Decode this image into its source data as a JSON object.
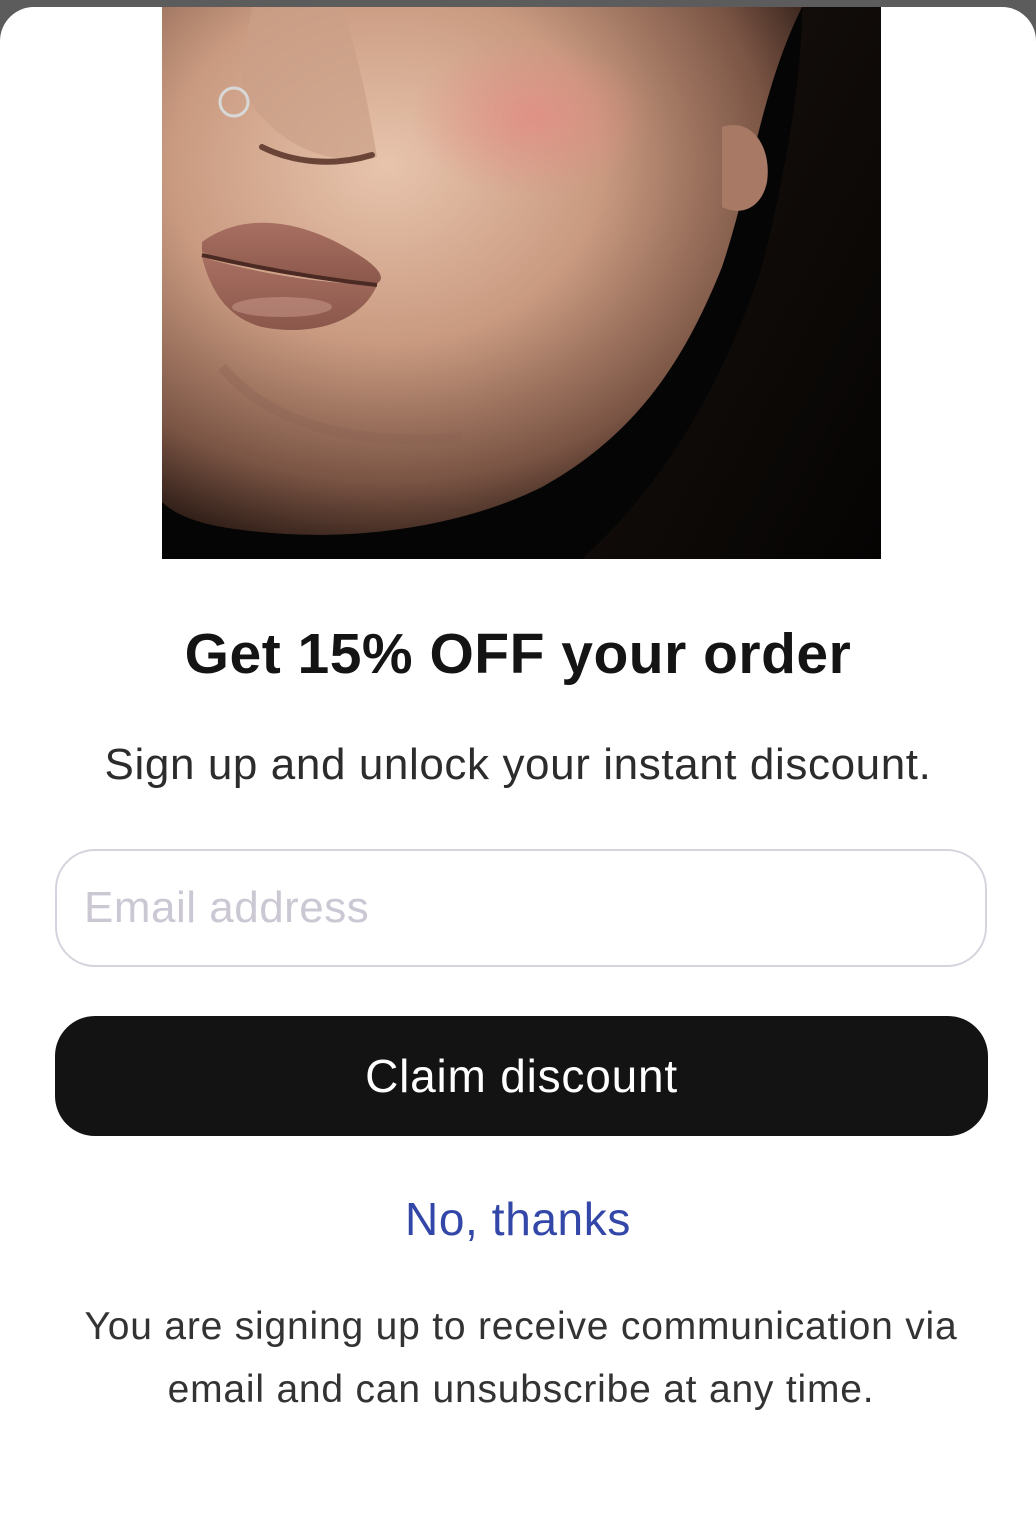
{
  "modal": {
    "headline": "Get 15% OFF your order",
    "subheadline": "Sign up and unlock your instant discount.",
    "email_placeholder": "Email address",
    "claim_label": "Claim discount",
    "dismiss_label": "No, thanks",
    "legal_text": "You are signing up to receive communication via email and can unsubscribe at any time."
  },
  "colors": {
    "button_background": "#131313",
    "link": "#3347a8",
    "input_border": "#d6d3de"
  }
}
